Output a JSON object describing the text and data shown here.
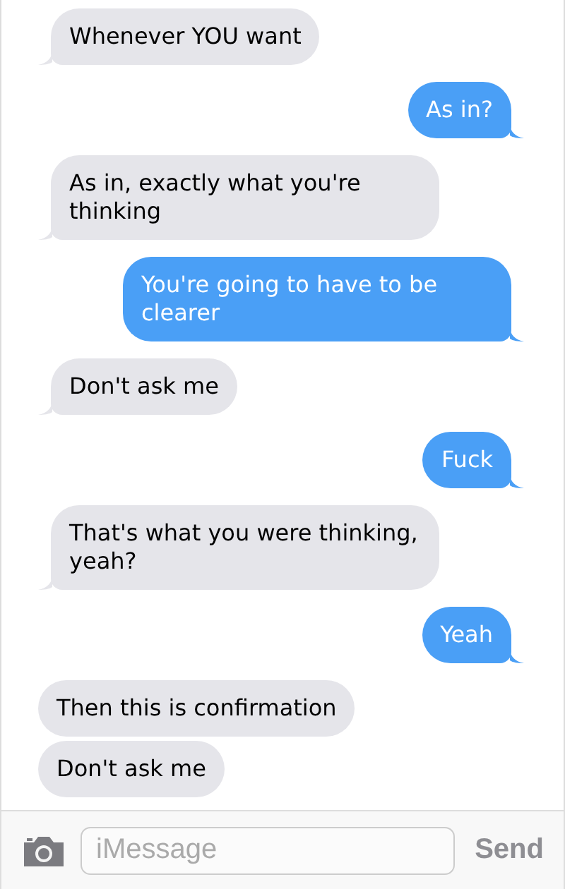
{
  "messages": [
    {
      "kind": "received",
      "text": "Whenever YOU want",
      "tail": true
    },
    {
      "kind": "sent",
      "text": "As in?",
      "tail": true
    },
    {
      "kind": "received",
      "text": "As in, exactly what you're thinking",
      "tail": true
    },
    {
      "kind": "sent",
      "text": "You're going to have to be clearer",
      "tail": true
    },
    {
      "kind": "received",
      "text": "Don't ask me",
      "tail": true
    },
    {
      "kind": "sent",
      "text": "Fuck",
      "tail": true
    },
    {
      "kind": "received",
      "text": "That's what you were thinking, yeah?",
      "tail": true
    },
    {
      "kind": "sent",
      "text": "Yeah",
      "tail": true
    },
    {
      "kind": "received",
      "text": "Then this is confirmation",
      "tail": false
    },
    {
      "kind": "received",
      "text": "Don't ask me",
      "tail": false
    }
  ],
  "composer": {
    "placeholder": "iMessage",
    "send": "Send"
  }
}
